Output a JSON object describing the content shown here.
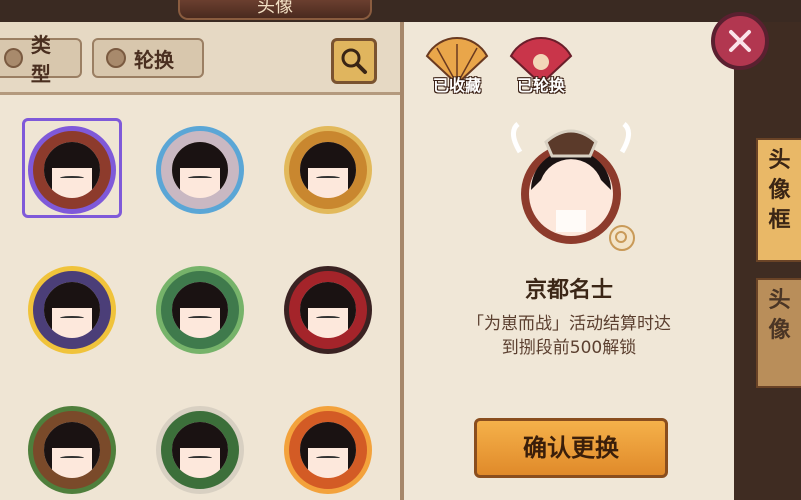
{
  "header": {
    "title": "头像"
  },
  "filters": {
    "type_label": "类型",
    "rotate_label": "轮换"
  },
  "status": {
    "collected_label": "已收藏",
    "rotated_label": "已轮换"
  },
  "preview": {
    "name": "京都名士",
    "description": "「为崽而战」活动结算时达到捌段前500解锁"
  },
  "actions": {
    "confirm_label": "确认更换"
  },
  "side_tabs": {
    "frame_label": "头像框",
    "avatar_label": "头像"
  },
  "colors": {
    "selected": "#7f59d9",
    "accent": "#e9a64a",
    "close": "#b23750"
  },
  "grid": {
    "items": [
      {
        "name": "avatar-samurai-helmet",
        "ring": "#8d3b2c",
        "accent": "#7f59d9"
      },
      {
        "name": "avatar-sakura",
        "ring": "#c9b8c2",
        "accent": "#5aa6d6"
      },
      {
        "name": "avatar-phoenix",
        "ring": "#c9872f",
        "accent": "#e2b95b"
      },
      {
        "name": "avatar-moon",
        "ring": "#4b3e78",
        "accent": "#f0c33b"
      },
      {
        "name": "avatar-jade",
        "ring": "#3f7a4c",
        "accent": "#76b36a"
      },
      {
        "name": "avatar-torii",
        "ring": "#a4242a",
        "accent": "#3a2222"
      },
      {
        "name": "avatar-pine",
        "ring": "#7a4a2a",
        "accent": "#4f7f3c"
      },
      {
        "name": "avatar-fox",
        "ring": "#3c6f3a",
        "accent": "#d8d0c2"
      },
      {
        "name": "avatar-skull",
        "ring": "#d35b25",
        "accent": "#f3a23c"
      }
    ]
  }
}
